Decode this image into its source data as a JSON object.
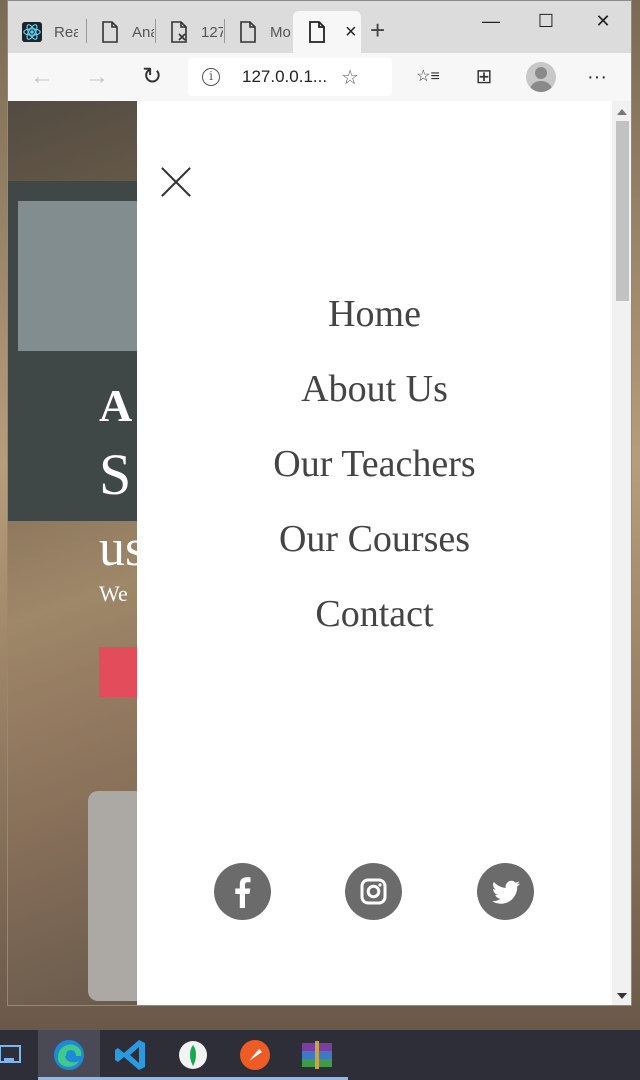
{
  "browser": {
    "tabs": [
      {
        "label": "Rea",
        "icon": "react-icon"
      },
      {
        "label": "Ana",
        "icon": "page-icon"
      },
      {
        "label": "127",
        "icon": "page-error-icon"
      },
      {
        "label": "Mo",
        "icon": "page-icon"
      },
      {
        "label": "",
        "icon": "page-icon",
        "close": "×"
      }
    ],
    "new_tab": "+",
    "window_controls": {
      "minimize": "—",
      "maximize": "☐",
      "close": "✕"
    },
    "address": {
      "url": "127.0.0.1...",
      "info": "i",
      "favorite": "☆"
    },
    "nav": {
      "back": "←",
      "forward": "→",
      "refresh": "↻"
    },
    "toolbar_icons": {
      "favorites": "☆≡",
      "collections": "⊞",
      "more": "···"
    }
  },
  "hero": {
    "line1": "A",
    "line2": "S",
    "line3": "us",
    "subline": "We",
    "accent_color": "#e34d5b"
  },
  "menu": {
    "items": [
      "Home",
      "About Us",
      "Our Teachers",
      "Our Courses",
      "Contact"
    ],
    "socials": [
      {
        "name": "facebook-icon",
        "glyph": "f"
      },
      {
        "name": "instagram-icon"
      },
      {
        "name": "twitter-icon"
      }
    ],
    "social_color": "#6b6b6b"
  },
  "taskbar": {
    "apps": [
      "task-view-icon",
      "edge-icon",
      "vscode-icon",
      "mongodb-compass-icon",
      "postman-icon",
      "winrar-icon"
    ]
  }
}
